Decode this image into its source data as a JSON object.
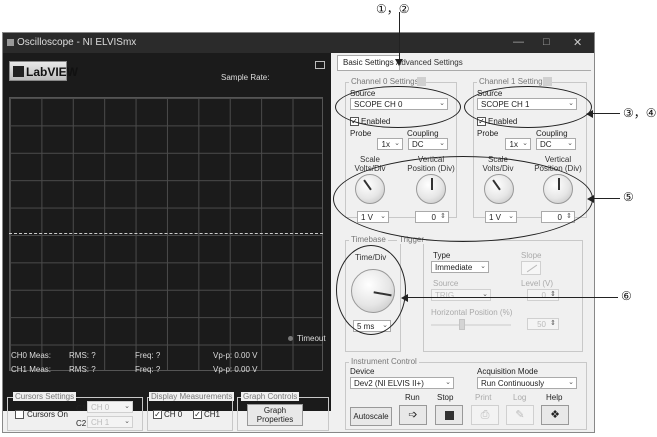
{
  "annotations": {
    "n12": "①，②",
    "n34": "③，④",
    "n5": "⑤",
    "n6": "⑥"
  },
  "window": {
    "title": "Oscilloscope - NI ELVISmx",
    "min_glyph": "—",
    "max_glyph": "□",
    "close_glyph": "✕"
  },
  "scope": {
    "logo_text": "LabVIEW",
    "sample_rate_label": "Sample Rate:",
    "timeout_label": "Timeout",
    "ch0": {
      "meas": "CH0 Meas:",
      "rms": "RMS: ?",
      "freq": "Freq: ?",
      "vpp": "Vp-p: 0.00 V"
    },
    "ch1": {
      "meas": "CH1 Meas:",
      "rms": "RMS: ?",
      "freq": "Freq: ?",
      "vpp": "Vp-p: 0.00 V"
    }
  },
  "cursors": {
    "group_label": "Cursors Settings",
    "on_label": "Cursors On",
    "c1_label": "C1",
    "c1_value": "CH 0",
    "c2_label": "C2",
    "c2_value": "CH 1"
  },
  "display_meas": {
    "group_label": "Display Measurements",
    "ch0_label": "CH 0",
    "ch1_label": "CH1"
  },
  "graph_controls": {
    "group_label": "Graph Controls",
    "button_line1": "Graph",
    "button_line2": "Properties"
  },
  "tabs": {
    "basic": "Basic Settings",
    "advanced": "Advanced Settings"
  },
  "channel0": {
    "group_label": "Channel 0 Settings",
    "source_label": "Source",
    "source_value": "SCOPE CH 0",
    "enabled_label": "Enabled",
    "probe_label": "Probe",
    "probe_value": "1x",
    "coupling_label": "Coupling",
    "coupling_value": "DC",
    "scale_label1": "Scale",
    "scale_label2": "Volts/Div",
    "scale_value": "1 V",
    "vpos_label1": "Vertical",
    "vpos_label2": "Position (Div)",
    "vpos_value": "0"
  },
  "channel1": {
    "group_label": "Channel 1 Settings",
    "source_label": "Source",
    "source_value": "SCOPE CH 1",
    "enabled_label": "Enabled",
    "probe_label": "Probe",
    "probe_value": "1x",
    "coupling_label": "Coupling",
    "coupling_value": "DC",
    "scale_label1": "Scale",
    "scale_label2": "Volts/Div",
    "scale_value": "1 V",
    "vpos_label1": "Vertical",
    "vpos_label2": "Position (Div)",
    "vpos_value": "0"
  },
  "timebase": {
    "group_label": "Timebase",
    "time_div_label": "Time/Div",
    "value": "5 ms"
  },
  "trigger": {
    "group_label": "Trigger",
    "type_label": "Type",
    "type_value": "Immediate",
    "slope_label": "Slope",
    "source_label": "Source",
    "source_value": "TRIG",
    "level_label": "Level (V)",
    "level_value": "0",
    "hpos_label": "Horizontal Position (%)",
    "hpos_value": "50"
  },
  "instrument": {
    "group_label": "Instrument Control",
    "device_label": "Device",
    "device_value": "Dev2 (NI ELVIS II+)",
    "acq_label": "Acquisition Mode",
    "acq_value": "Run Continuously",
    "run_label": "Run",
    "stop_label": "Stop",
    "print_label": "Print",
    "log_label": "Log",
    "help_label": "Help",
    "autoscale_label": "Autoscale"
  },
  "colors": {
    "annotation": "#222222",
    "scope_bg": "#1b1b1b",
    "titlebar": "#2b2b2b"
  }
}
